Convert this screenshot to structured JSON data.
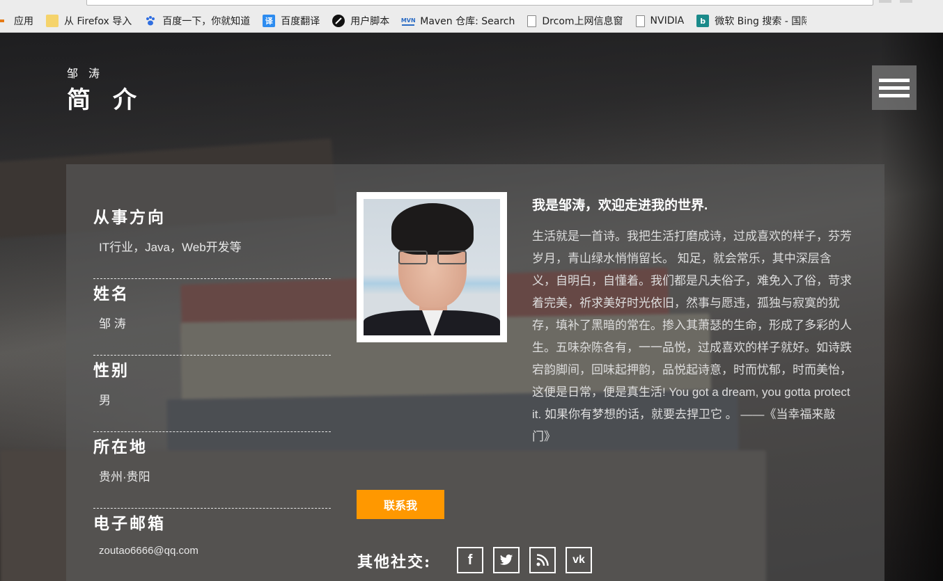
{
  "bookmarks": [
    {
      "label": "应用",
      "icon": "apps-icon"
    },
    {
      "label": "从 Firefox 导入",
      "icon": "folder-icon"
    },
    {
      "label": "百度一下，你就知道",
      "icon": "baidu-icon"
    },
    {
      "label": "百度翻译",
      "icon": "translate-icon",
      "glyph": "译"
    },
    {
      "label": "用户脚本",
      "icon": "userscript-icon"
    },
    {
      "label": "Maven 仓库: Search",
      "icon": "maven-icon",
      "glyph": "MVN"
    },
    {
      "label": "Drcom上网信息窗",
      "icon": "page-icon"
    },
    {
      "label": "NVIDIA",
      "icon": "page-icon"
    },
    {
      "label": "微软 Bing 搜索 - 国际",
      "icon": "bing-icon",
      "glyph": "b"
    }
  ],
  "header": {
    "name_small": "邹涛",
    "title": "简介"
  },
  "info": [
    {
      "label": "从事方向",
      "value": "IT行业，Java，Web开发等"
    },
    {
      "label": "姓名",
      "value": "邹 涛"
    },
    {
      "label": "性别",
      "value": "男"
    },
    {
      "label": "所在地",
      "value": "贵州·贵阳"
    },
    {
      "label": "电子邮箱",
      "value": "zoutao6666@qq.com"
    }
  ],
  "intro": {
    "title": "我是邹涛，欢迎走进我的世界.",
    "text": "生活就是一首诗。我把生活打磨成诗，过成喜欢的样子，芬芳岁月，青山绿水悄悄留长。 知足，就会常乐，其中深层含义，自明白，自懂着。我们都是凡夫俗子，难免入了俗，苛求着完美，祈求美好时光依旧，然事与愿违，孤独与寂寞的犹存，填补了黑暗的常在。掺入其萧瑟的生命，形成了多彩的人生。五味杂陈各有，一一品悦，过成喜欢的样子就好。如诗跌宕韵脚间，回味起押韵，品悦起诗意，时而忧郁，时而美怡，这便是日常，便是真生活! You got a dream, you gotta protect it. 如果你有梦想的话，就要去捍卫它 。 ——《当幸福来敲门》"
  },
  "contact_button": "联系我",
  "social": {
    "label": "其他社交:",
    "items": [
      {
        "name": "facebook-icon",
        "glyph": "f"
      },
      {
        "name": "twitter-icon"
      },
      {
        "name": "rss-icon"
      },
      {
        "name": "vk-icon",
        "glyph": "vk"
      }
    ]
  },
  "colors": {
    "accent": "#ff9800",
    "card_bg": "rgba(90,90,90,0.62)"
  }
}
